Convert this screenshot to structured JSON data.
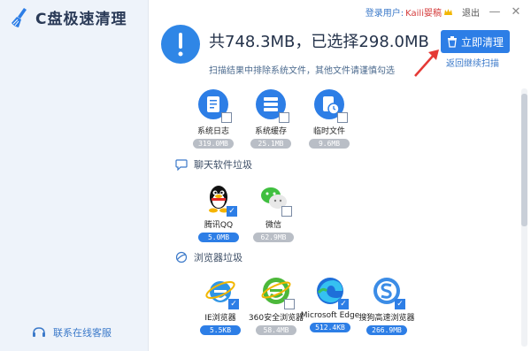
{
  "app": {
    "title": "C盘极速清理"
  },
  "topbar": {
    "login_label": "登录用户:",
    "username": "Kaili婴稿",
    "logout": "退出",
    "minimize": "—",
    "close": "✕"
  },
  "summary": {
    "title": "共748.3MB，已选择298.0MB",
    "subtitle": "扫描结果中排除系统文件，其他文件请谨慎勾选"
  },
  "actions": {
    "clean_now": "立即清理",
    "rescan": "返回继续扫描"
  },
  "system_items": [
    {
      "label": "系统日志",
      "size": "319.0MB",
      "checked": false,
      "icon": "system-log-icon"
    },
    {
      "label": "系统缓存",
      "size": "25.1MB",
      "checked": false,
      "icon": "system-cache-icon"
    },
    {
      "label": "临时文件",
      "size": "9.6MB",
      "checked": false,
      "icon": "temp-files-icon"
    }
  ],
  "chat_section": {
    "title": "聊天软件垃圾",
    "items": [
      {
        "label": "腾讯QQ",
        "size": "5.0MB",
        "checked": true,
        "icon": "qq-penguin-icon"
      },
      {
        "label": "微信",
        "size": "62.9MB",
        "checked": false,
        "icon": "wechat-icon"
      }
    ]
  },
  "browser_section": {
    "title": "浏览器垃圾",
    "items": [
      {
        "label": "IE浏览器",
        "size": "5.5KB",
        "checked": true,
        "icon": "ie-icon"
      },
      {
        "label": "360安全浏览器",
        "size": "58.4MB",
        "checked": false,
        "icon": "360-browser-icon"
      },
      {
        "label": "Microsoft Edge",
        "size": "512.4KB",
        "checked": true,
        "icon": "edge-icon"
      },
      {
        "label": "搜狗高速浏览器",
        "size": "266.9MB",
        "checked": true,
        "icon": "sogou-browser-icon"
      }
    ]
  },
  "support": {
    "label": "联系在线客服"
  },
  "colors": {
    "accent": "#2d7ee6",
    "disabled": "#b9bec6",
    "username": "#d43b3b"
  }
}
